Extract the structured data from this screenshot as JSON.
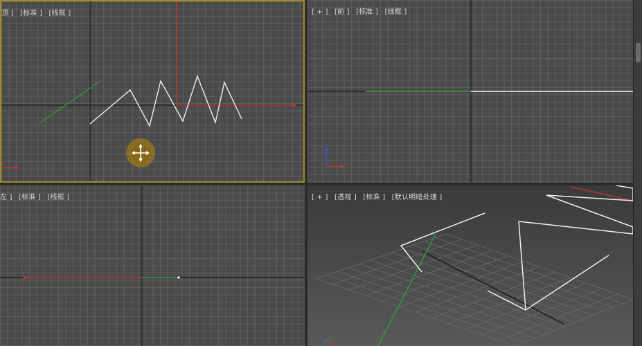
{
  "viewports": {
    "top": {
      "labels": [
        "顶 ]",
        "[标准 ]",
        "[线框 ]"
      ]
    },
    "front": {
      "labels": [
        "[ + ]",
        "[前 ]",
        "[标准 ]",
        "[线框 ]"
      ]
    },
    "left": {
      "labels": [
        "左 ]",
        "[标准 ]",
        "[线框 ]"
      ]
    },
    "perspective": {
      "labels": [
        "[ + ]",
        "[透视 ]",
        "[标准 ]",
        "[默认明暗处理 ]"
      ]
    }
  },
  "colors": {
    "active_border": "#a48b2e",
    "axis_x": "#c0392b",
    "axis_y": "#2f9e3a",
    "axis_z": "#3a5bd8",
    "spline": "#ffffff",
    "cursor_glow": "#b8860b"
  },
  "icons": {
    "move_cursor": "move-cursor-icon",
    "axis_gizmo": "axis-gizmo-icon"
  }
}
